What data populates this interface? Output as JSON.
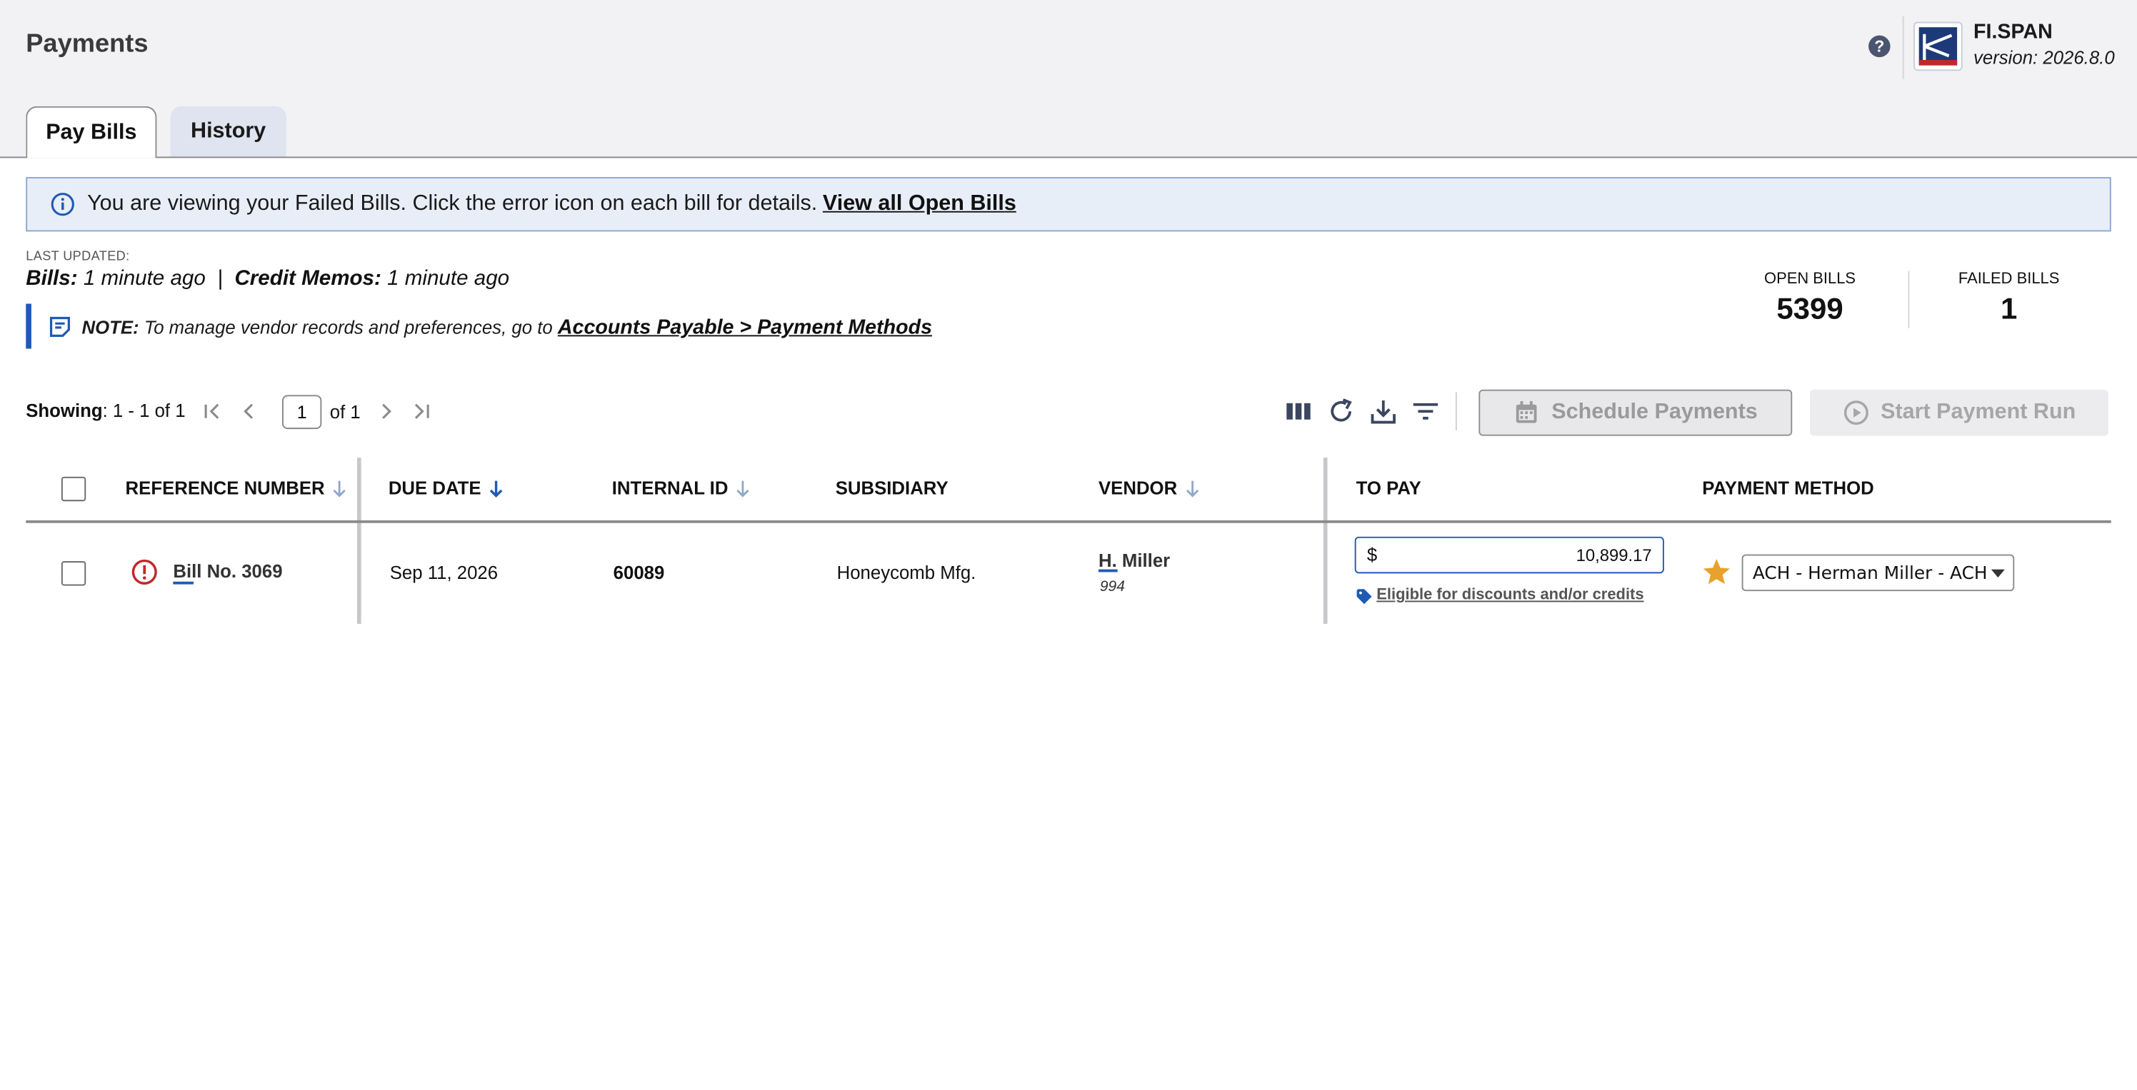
{
  "header": {
    "title": "Payments",
    "help_icon": "help-icon",
    "brand_name": "FI.SPAN",
    "version": "version: 2026.8.0"
  },
  "tabs": [
    {
      "label": "Pay Bills",
      "active": true
    },
    {
      "label": "History",
      "active": false
    }
  ],
  "banner": {
    "text": "You are viewing your Failed Bills. Click the error icon on each bill for details.",
    "link": "View all Open Bills"
  },
  "updated": {
    "label": "LAST UPDATED:",
    "bills_label": "Bills:",
    "bills_value": "1 minute ago",
    "separator": "|",
    "memos_label": "Credit Memos:",
    "memos_value": "1 minute ago"
  },
  "note": {
    "label": "NOTE:",
    "text": "To manage vendor records and preferences, go to",
    "link": "Accounts Payable > Payment Methods"
  },
  "stats": {
    "open_bills_label": "OPEN BILLS",
    "open_bills_value": "5399",
    "failed_bills_label": "FAILED BILLS",
    "failed_bills_value": "1"
  },
  "pagination": {
    "showing_label": "Showing",
    "showing_range": ": 1 - 1 of 1",
    "page_value": "1",
    "of_text": "of 1"
  },
  "toolbar": {
    "schedule_label": "Schedule Payments",
    "start_run_label": "Start Payment Run"
  },
  "table": {
    "columns": {
      "reference": "REFERENCE NUMBER",
      "due_date": "DUE DATE",
      "internal_id": "INTERNAL ID",
      "subsidiary": "SUBSIDIARY",
      "vendor": "VENDOR",
      "to_pay": "TO PAY",
      "payment_method": "PAYMENT METHOD"
    },
    "rows": [
      {
        "reference": "Bill No. 3069",
        "due_date": "Sep 11, 2026",
        "internal_id": "60089",
        "subsidiary": "Honeycomb Mfg.",
        "vendor_name": "H. Miller",
        "vendor_id": "994",
        "currency": "$",
        "to_pay": "10,899.17",
        "discount_link": "Eligible for discounts and/or credits",
        "payment_method": "ACH - Herman Miller - ACH"
      }
    ]
  },
  "colors": {
    "accent": "#1f5bb5",
    "error": "#c0282d",
    "star": "#e8a12a",
    "banner_bg": "#e8eef8"
  }
}
